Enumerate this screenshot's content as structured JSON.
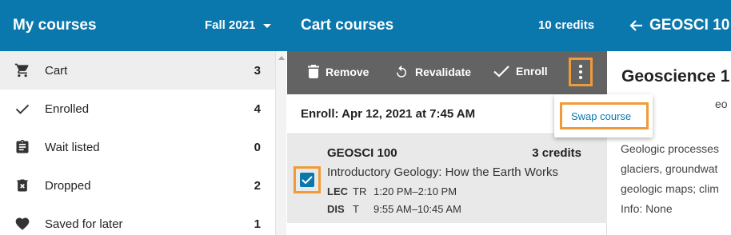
{
  "header": {
    "left_title": "My courses",
    "term": "Fall 2021",
    "middle_title": "Cart courses",
    "credits": "10 credits",
    "right_title": "GEOSCI 10"
  },
  "sidebar": {
    "items": [
      {
        "label": "Cart",
        "count": "3",
        "icon": "cart-icon"
      },
      {
        "label": "Enrolled",
        "count": "4",
        "icon": "checkmark-icon"
      },
      {
        "label": "Wait listed",
        "count": "0",
        "icon": "clipboard-icon"
      },
      {
        "label": "Dropped",
        "count": "2",
        "icon": "trash-x-icon"
      },
      {
        "label": "Saved for later",
        "count": "1",
        "icon": "heart-icon"
      }
    ]
  },
  "toolbar": {
    "remove_label": "Remove",
    "revalidate_label": "Revalidate",
    "enroll_label": "Enroll"
  },
  "enroll_date": "Enroll: Apr 12, 2021 at 7:45 AM",
  "course": {
    "code": "GEOSCI 100",
    "credits": "3 credits",
    "title": "Introductory Geology: How the Earth Works",
    "sections": [
      {
        "type": "LEC",
        "days": "TR",
        "time": "1:20 PM–2:10 PM"
      },
      {
        "type": "DIS",
        "days": "T",
        "time": "9:55 AM–10:45 AM"
      }
    ]
  },
  "detail": {
    "title": "Geoscience 1",
    "line1": "eo",
    "line2": "Geologic processes",
    "line3": "glaciers, groundwat",
    "line4": "geologic maps; clim",
    "line5": "Info: None"
  },
  "menu": {
    "swap_label": "Swap course"
  },
  "colors": {
    "primary": "#0a77ad",
    "toolbar": "#636363",
    "highlight": "#f19a38"
  }
}
